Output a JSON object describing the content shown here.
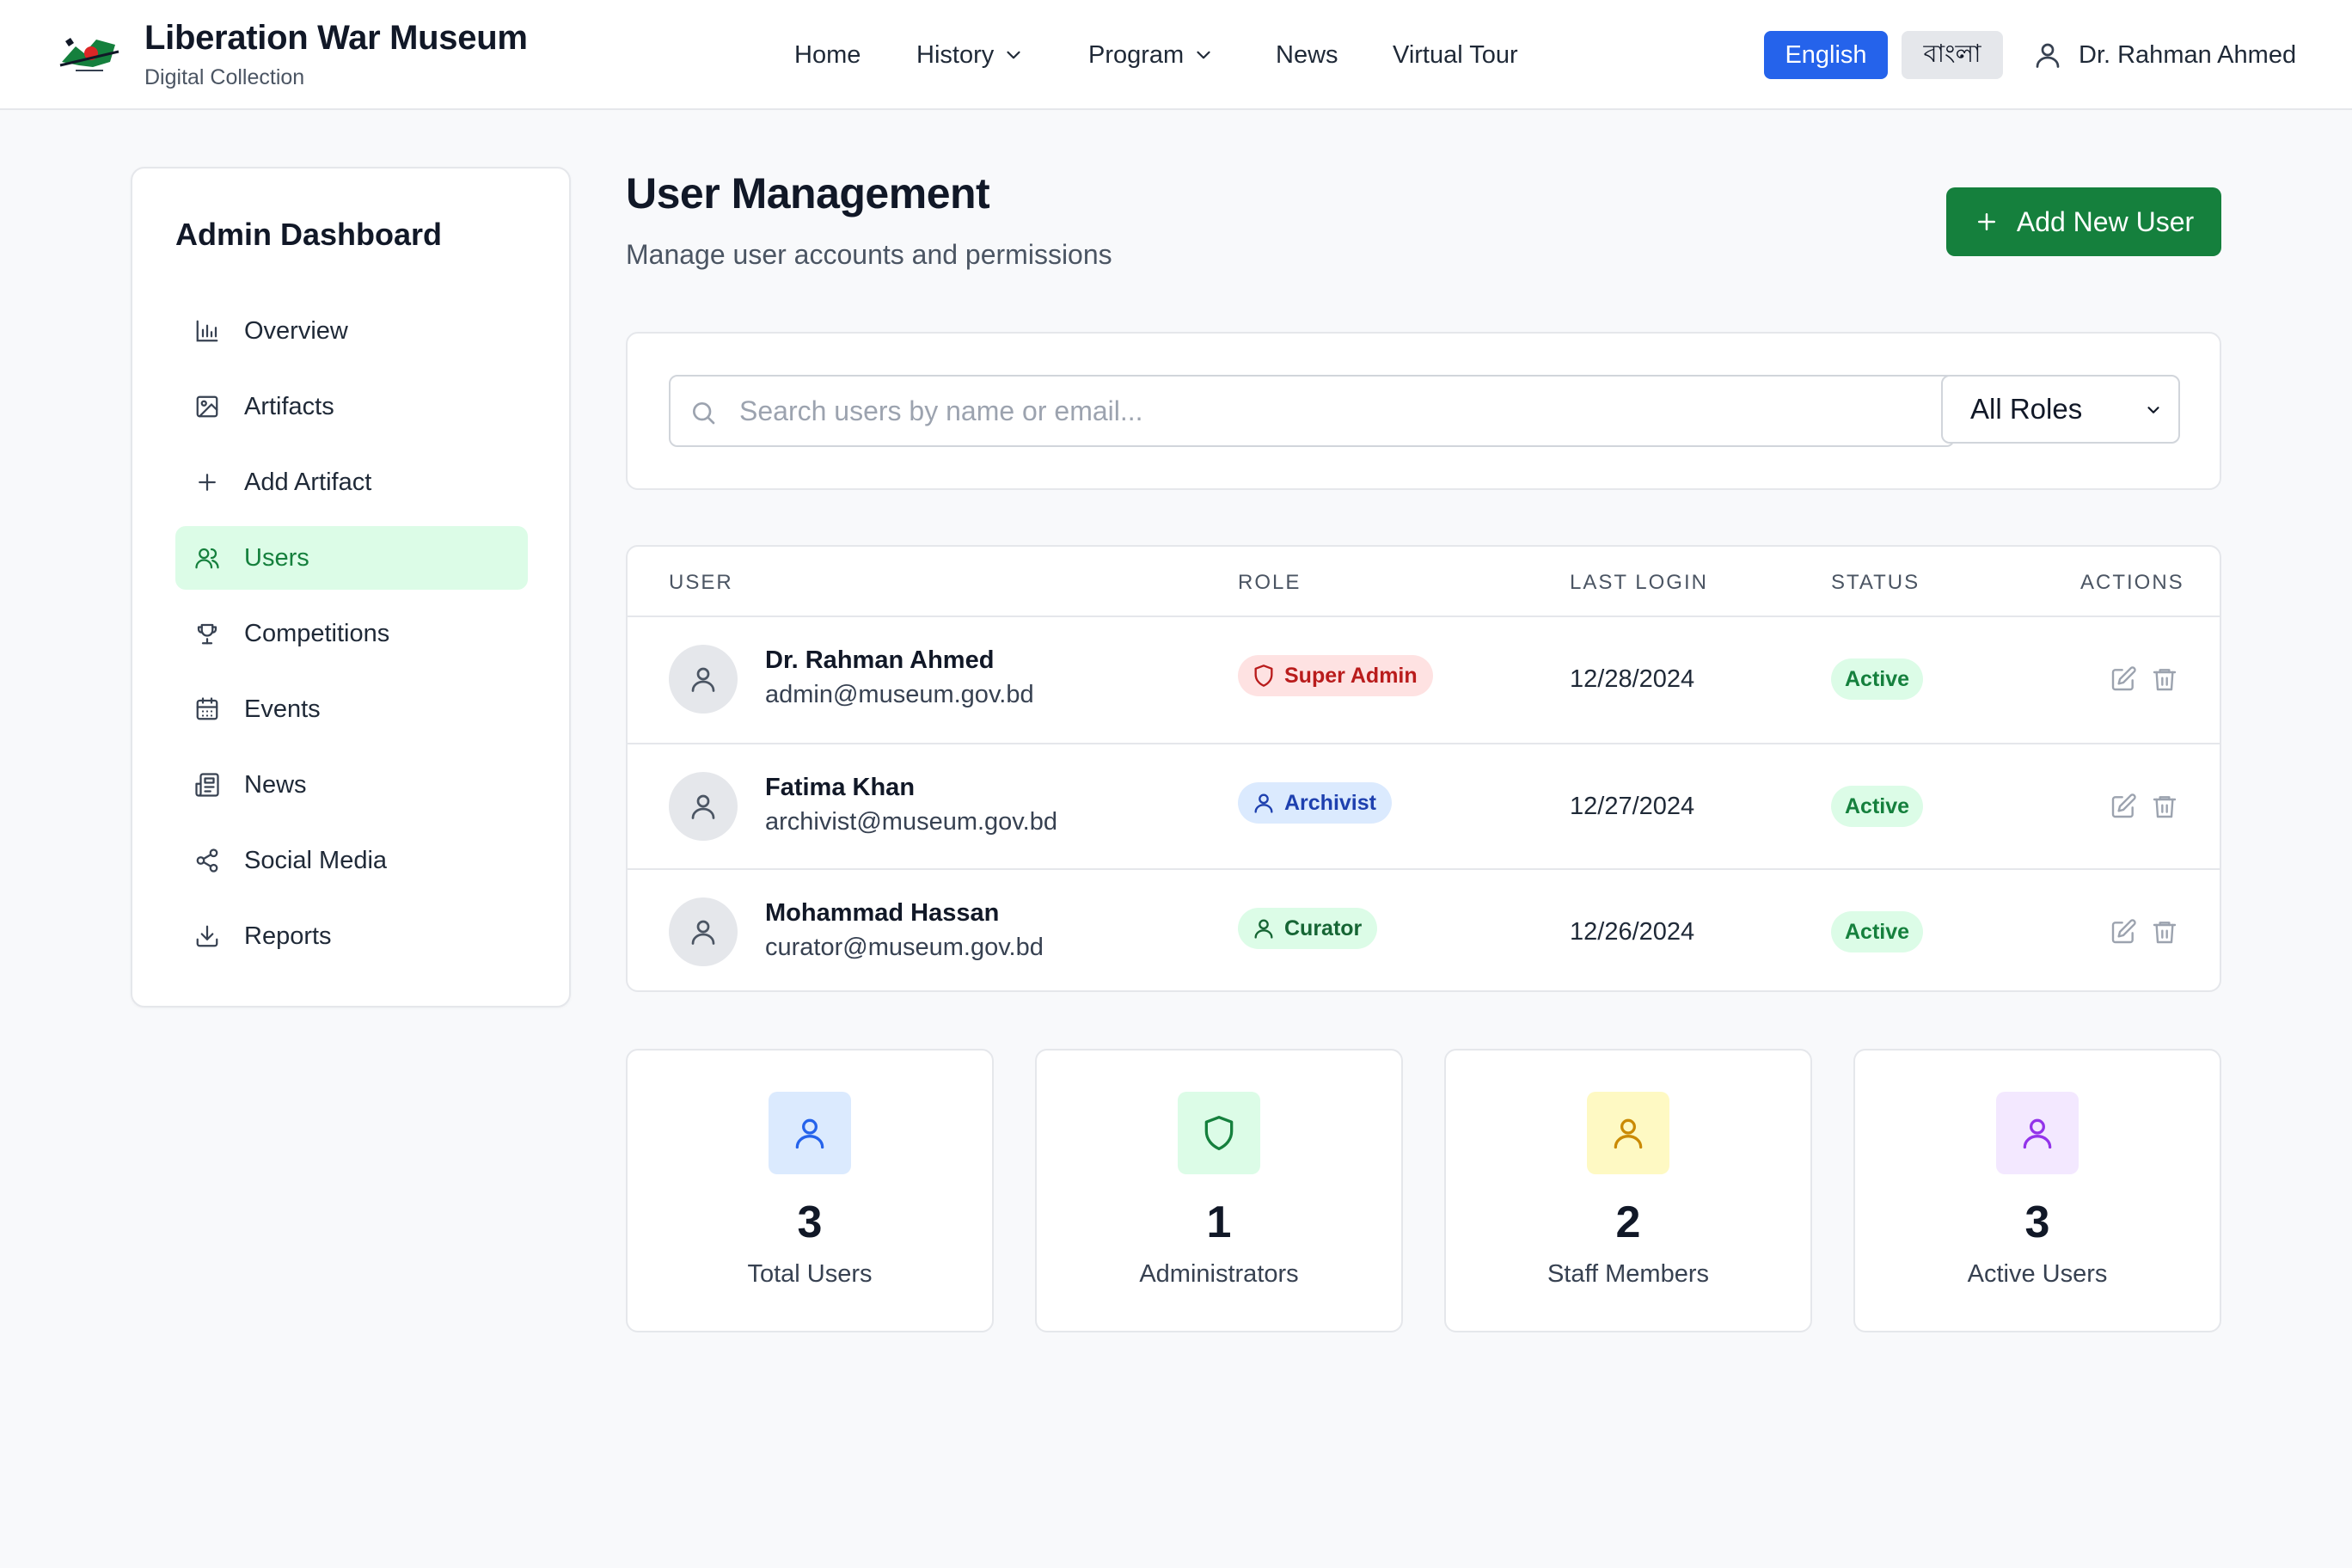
{
  "header": {
    "title": "Liberation War Museum",
    "subtitle": "Digital Collection",
    "nav": [
      {
        "label": "Home",
        "icon": null
      },
      {
        "label": "History",
        "icon": "chevron-down-icon"
      },
      {
        "label": "Program",
        "icon": "chevron-down-icon"
      },
      {
        "label": "News",
        "icon": null
      },
      {
        "label": "Virtual Tour",
        "icon": null
      }
    ],
    "lang_en": "English",
    "lang_bn": "বাংলা",
    "user_name": "Dr. Rahman Ahmed"
  },
  "sidebar": {
    "title": "Admin Dashboard",
    "items": [
      {
        "label": "Overview",
        "icon": "bar-chart-icon"
      },
      {
        "label": "Artifacts",
        "icon": "image-icon"
      },
      {
        "label": "Add Artifact",
        "icon": "plus-icon"
      },
      {
        "label": "Users",
        "icon": "users-icon",
        "active": true
      },
      {
        "label": "Competitions",
        "icon": "trophy-icon"
      },
      {
        "label": "Events",
        "icon": "calendar-icon"
      },
      {
        "label": "News",
        "icon": "newspaper-icon"
      },
      {
        "label": "Social Media",
        "icon": "share-icon"
      },
      {
        "label": "Reports",
        "icon": "download-icon"
      }
    ]
  },
  "main": {
    "title": "User Management",
    "subtitle": "Manage user accounts and permissions",
    "add_button": "Add New User",
    "search": {
      "placeholder": "Search users by name or email...",
      "value": ""
    },
    "role_filter": {
      "selected": "All Roles"
    },
    "table": {
      "headers": [
        "USER",
        "ROLE",
        "LAST LOGIN",
        "STATUS",
        "ACTIONS"
      ],
      "rows": [
        {
          "name": "Dr. Rahman Ahmed",
          "email": "admin@museum.gov.bd",
          "role": "Super Admin",
          "role_icon": "shield-icon",
          "last_login": "12/28/2024",
          "status": "Active"
        },
        {
          "name": "Fatima Khan",
          "email": "archivist@museum.gov.bd",
          "role": "Archivist",
          "role_icon": "user-icon",
          "last_login": "12/27/2024",
          "status": "Active"
        },
        {
          "name": "Mohammad Hassan",
          "email": "curator@museum.gov.bd",
          "role": "Curator",
          "role_icon": "user-icon",
          "last_login": "12/26/2024",
          "status": "Active"
        }
      ]
    },
    "stats": [
      {
        "value": "3",
        "label": "Total Users",
        "icon": "user-icon",
        "color": "#2563eb",
        "bg": "#dbeafe"
      },
      {
        "value": "1",
        "label": "Administrators",
        "icon": "shield-icon",
        "color": "#15803d",
        "bg": "#dcfce7"
      },
      {
        "value": "2",
        "label": "Staff Members",
        "icon": "user-icon",
        "color": "#ca8a04",
        "bg": "#fef9c3"
      },
      {
        "value": "3",
        "label": "Active Users",
        "icon": "user-icon",
        "color": "#9333ea",
        "bg": "#f3e8ff"
      }
    ]
  },
  "colors": {
    "primary": "#2563eb",
    "accent_green": "#15803d",
    "super_admin": "#b91c1c",
    "archivist": "#1e40af",
    "curator": "#166534"
  }
}
